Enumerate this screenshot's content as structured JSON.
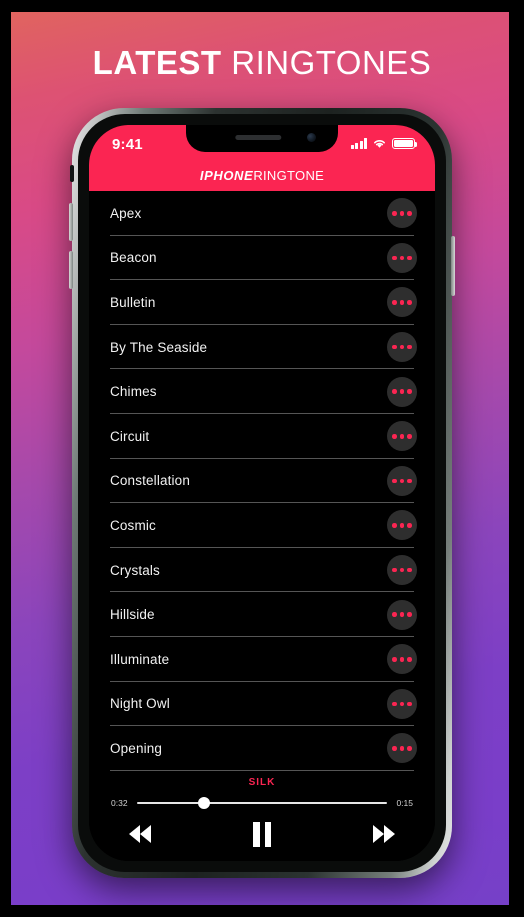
{
  "headline": {
    "bold": "LATEST",
    "light": " RINGTONES"
  },
  "phone": {
    "status_bar": {
      "time": "9:41",
      "signal_icon": "cellular-bars-icon",
      "wifi_icon": "wifi-icon",
      "battery_icon": "battery-full-icon"
    },
    "app_title": {
      "bold": "IPHONE",
      "light": "RINGTONE"
    },
    "hardware": {
      "silent_switch": "silent-switch",
      "volume_up": "volume-up-button",
      "volume_down": "volume-down-button",
      "power": "power-button"
    }
  },
  "list": {
    "menu_icon": "more-options-icon",
    "items": [
      {
        "name": "Apex"
      },
      {
        "name": "Beacon"
      },
      {
        "name": "Bulletin"
      },
      {
        "name": "By The Seaside"
      },
      {
        "name": "Chimes"
      },
      {
        "name": "Circuit"
      },
      {
        "name": "Constellation"
      },
      {
        "name": "Cosmic"
      },
      {
        "name": "Crystals"
      },
      {
        "name": "Hillside"
      },
      {
        "name": "Illuminate"
      },
      {
        "name": "Night Owl"
      },
      {
        "name": "Opening"
      }
    ]
  },
  "player": {
    "now_playing": "SILK",
    "elapsed_time": "0:32",
    "remaining_time": "0:15",
    "progress_percent": 27,
    "rewind_icon": "rewind-icon",
    "pause_icon": "pause-icon",
    "forward_icon": "fast-forward-icon",
    "home_indicator": "home-indicator"
  },
  "colors": {
    "accent": "#fb2552",
    "screen_bg": "#000000",
    "gradient_start": "#e0645f",
    "gradient_mid": "#c4499c",
    "gradient_end": "#7640c8"
  }
}
